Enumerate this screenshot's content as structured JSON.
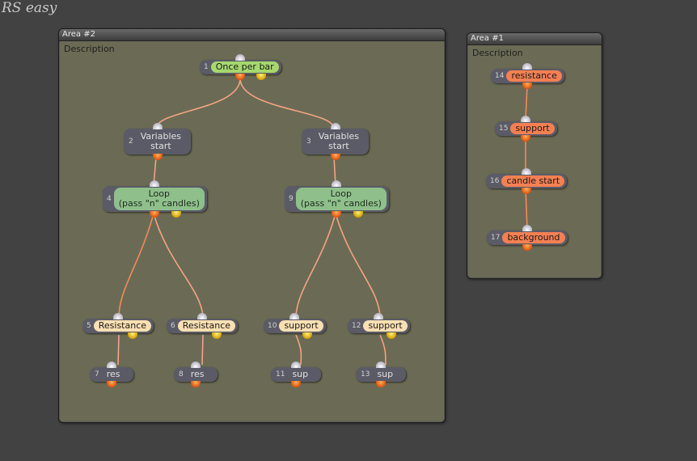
{
  "app_title": "RS easy",
  "areas": {
    "area2": {
      "title": "Area #2",
      "description": "Description"
    },
    "area1": {
      "title": "Area #1",
      "description": "Description"
    }
  },
  "nodes": {
    "n1": {
      "num": "1",
      "label": "Once per bar"
    },
    "n2": {
      "num": "2",
      "label1": "Variables",
      "label2": "start"
    },
    "n3": {
      "num": "3",
      "label1": "Variables",
      "label2": "start"
    },
    "n4": {
      "num": "4",
      "label1": "Loop",
      "label2": "(pass \"n\" candles)"
    },
    "n9": {
      "num": "9",
      "label1": "Loop",
      "label2": "(pass \"n\" candles)"
    },
    "n5": {
      "num": "5",
      "label": "Resistance"
    },
    "n6": {
      "num": "6",
      "label": "Resistance"
    },
    "n10": {
      "num": "10",
      "label": "support"
    },
    "n12": {
      "num": "12",
      "label": "support"
    },
    "n7": {
      "num": "7",
      "label": "res"
    },
    "n8": {
      "num": "8",
      "label": "res"
    },
    "n11": {
      "num": "11",
      "label": "sup"
    },
    "n13": {
      "num": "13",
      "label": "sup"
    },
    "n14": {
      "num": "14",
      "label": "resistance"
    },
    "n15": {
      "num": "15",
      "label": "support"
    },
    "n16": {
      "num": "16",
      "label": "candle start"
    },
    "n17": {
      "num": "17",
      "label": "background"
    }
  },
  "colors": {
    "canvas": "#424242",
    "area": "#6b6b55",
    "green_label": "#a6d86e",
    "loop_label": "#8fc08b",
    "beige_label": "#f9dfb2",
    "orange_label": "#f48052",
    "link": "#f2a07a"
  }
}
